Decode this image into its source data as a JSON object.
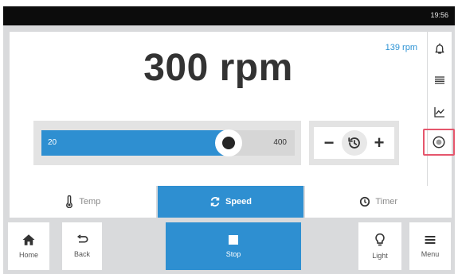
{
  "status": {
    "time": "19:56"
  },
  "display": {
    "setpoint": "300 rpm",
    "actual": "139 rpm"
  },
  "slider": {
    "min_label": "20",
    "max_label": "400",
    "fraction": 0.74
  },
  "tabs": [
    {
      "label": "Temp",
      "icon": "thermometer-icon",
      "active": false
    },
    {
      "label": "Speed",
      "icon": "refresh-icon",
      "active": true
    },
    {
      "label": "Timer",
      "icon": "clock-icon",
      "active": false
    }
  ],
  "right_rail": [
    {
      "icon": "bell-icon"
    },
    {
      "icon": "list-icon"
    },
    {
      "icon": "chart-icon"
    },
    {
      "icon": "record-icon",
      "selected": true
    }
  ],
  "bottom_nav": {
    "home": "Home",
    "back": "Back",
    "stop": "Stop",
    "light": "Light",
    "menu": "Menu"
  },
  "colors": {
    "accent": "#2e8fd1",
    "actual_text": "#2d93d4",
    "highlight": "#e5566c"
  }
}
